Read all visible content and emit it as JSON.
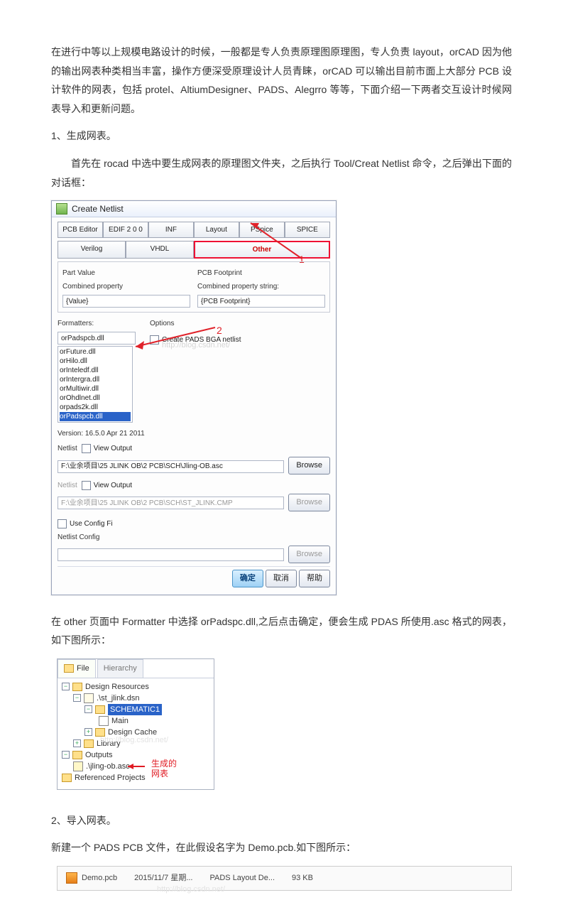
{
  "para1": "在进行中等以上规模电路设计的时候，一般都是专人负责原理图原理图，专人负责 layout，orCAD 因为他的输出网表种类相当丰富，操作方便深受原理设计人员青睐，orCAD 可以输出目前市面上大部分 PCB 设计软件的网表，包括 protel、AltiumDesigner、PADS、Alegrro 等等，下面介绍一下两者交互设计时候网表导入和更新问题。",
  "h1": "1、生成网表。",
  "para2": "首先在 rocad 中选中要生成网表的原理图文件夹，之后执行 Tool/Creat Netlist 命令，之后弹出下面的对话框：",
  "dialog": {
    "title": "Create Netlist",
    "tabsRow1": [
      "PCB Editor",
      "EDIF 2 0 0",
      "INF",
      "Layout",
      "PSpice",
      "SPICE"
    ],
    "tabsRow2": [
      "Verilog",
      "VHDL",
      "Other"
    ],
    "partValue": "Part Value",
    "combinedProp": "Combined property",
    "valueField": "{Value}",
    "pcbFootprint": "PCB Footprint",
    "combinedPropStr": "Combined property string:",
    "pcbField": "{PCB Footprint}",
    "formatters": "Formatters:",
    "formatterSel": "orPadspcb.dll",
    "formatterList": [
      "orFuture.dll",
      "orHilo.dll",
      "orInteledf.dll",
      "orIntergra.dll",
      "orMultiwir.dll",
      "orOhdlnet.dll",
      "orpads2k.dll",
      "orPadspcb.dll"
    ],
    "options": "Options",
    "optCreatePads": "Create PADS BGA netlist",
    "version": "Version: 16.5.0  Apr 21 2011",
    "netlist1Label": "Netlist",
    "viewOutput": "View Output",
    "net1Path": "F:\\业余项目\\25 JLINK OB\\2 PCB\\SCH\\Jling-OB.asc",
    "browse": "Browse",
    "netlist2Label": "Netlist",
    "net2Path": "F:\\业余项目\\25 JLINK OB\\2 PCB\\SCH\\ST_JLINK.CMP",
    "useConfig": "Use Config Fi",
    "netConfig": "Netlist Config",
    "btnOk": "确定",
    "btnCancel": "取消",
    "btnHelp": "帮助",
    "anno1": "1",
    "anno2": "2",
    "watermark": "http://blog.csdn.net/"
  },
  "para3": "在 other 页面中 Formatter 中选择 orPadspc.dll,之后点击确定，便会生成 PDAS 所使用.asc 格式的网表，如下图所示：",
  "tree": {
    "tabFile": "File",
    "tabHier": "Hierarchy",
    "root": "Design Resources",
    "dsn": ".\\st_jlink.dsn",
    "schem": "SCHEMATIC1",
    "main": "Main",
    "designCache": "Design Cache",
    "library": "Library",
    "outputs": "Outputs",
    "asc": ".\\jling-ob.asc",
    "refProj": "Referenced Projects",
    "annoA": "生成的",
    "annoB": "网表",
    "watermark": "http://blog.csdn.net/"
  },
  "h2": "2、导入网表。",
  "para4": "新建一个 PADS  PCB 文件，在此假设名字为 Demo.pcb.如下图所示：",
  "fileRow": {
    "name": "Demo.pcb",
    "date": "2015/11/7 星期...",
    "type": "PADS Layout De...",
    "size": "93 KB",
    "watermark": "http://blog.csdn.net/"
  }
}
